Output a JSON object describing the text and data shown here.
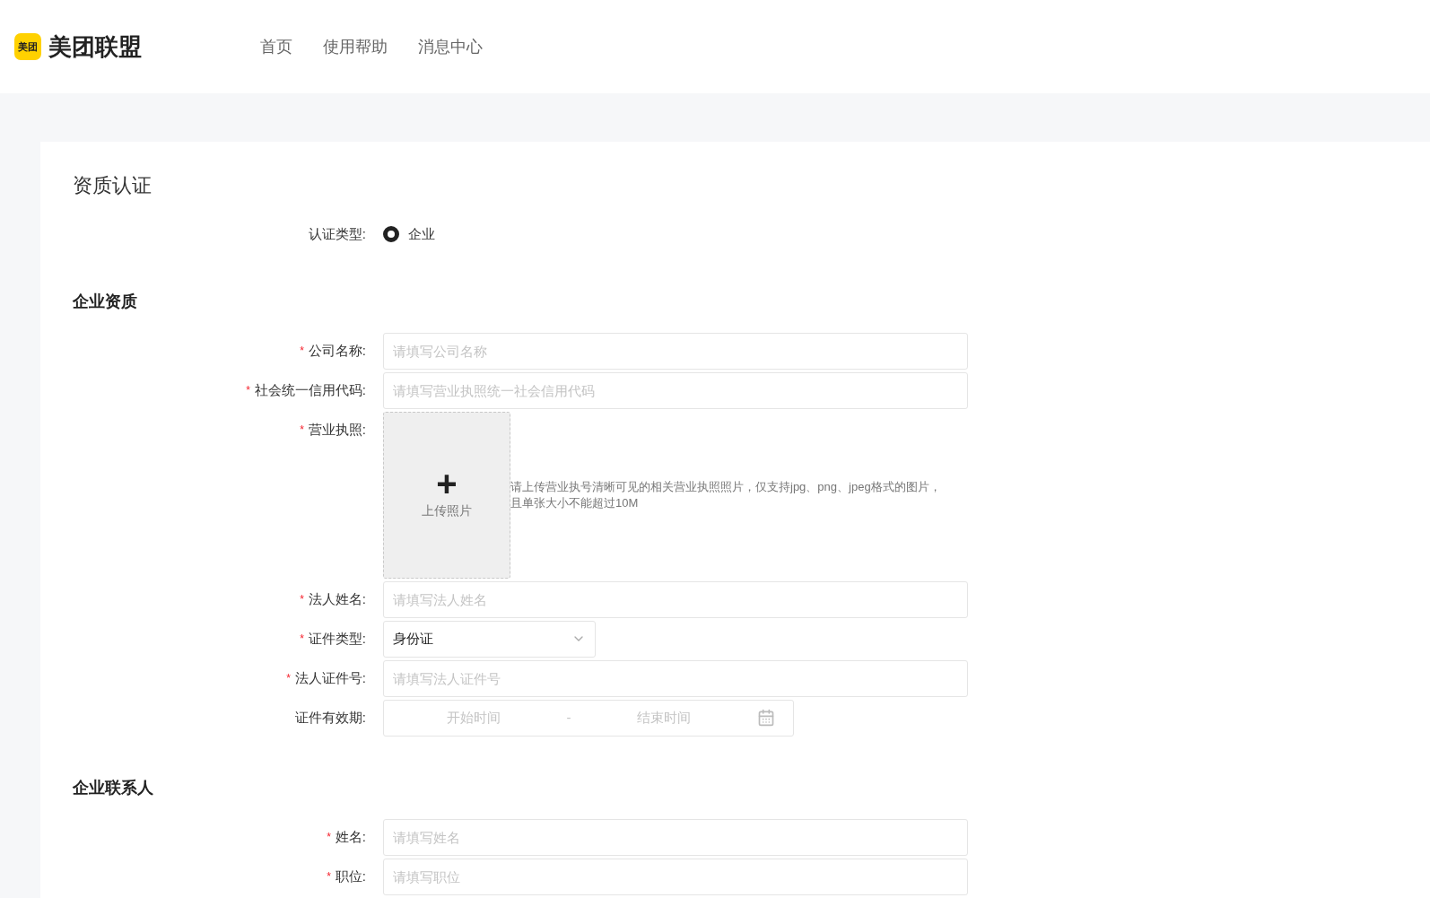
{
  "header": {
    "logo_badge": "美团",
    "logo_text": "美团联盟",
    "nav": [
      {
        "label": "首页"
      },
      {
        "label": "使用帮助"
      },
      {
        "label": "消息中心"
      }
    ]
  },
  "page_title": "资质认证",
  "cert_type": {
    "label": "认证类型:",
    "options": [
      {
        "label": "企业",
        "selected": true
      }
    ]
  },
  "sections": [
    {
      "title": "企业资质",
      "fields": [
        {
          "kind": "text",
          "label": "公司名称:",
          "required_mark": "*",
          "placeholder": "请填写公司名称"
        },
        {
          "kind": "text",
          "label": "社会统一信用代码:",
          "required_mark": "*",
          "placeholder": "请填写营业执照统一社会信用代码"
        },
        {
          "kind": "upload",
          "label": "营业执照:",
          "required_mark": "*",
          "button_icon": "+",
          "button_label": "上传照片",
          "hint": "请上传营业执号清晰可见的相关营业执照照片，仅支持jpg、png、jpeg格式的图片，且单张大小不能超过10M"
        },
        {
          "kind": "text",
          "label": "法人姓名:",
          "required_mark": "*",
          "placeholder": "请填写法人姓名"
        },
        {
          "kind": "select",
          "label": "证件类型:",
          "required_mark": "*",
          "value": "身份证"
        },
        {
          "kind": "text",
          "label": "法人证件号:",
          "required_mark": "*",
          "placeholder": "请填写法人证件号"
        },
        {
          "kind": "daterange",
          "label": "证件有效期:",
          "start_placeholder": "开始时间",
          "separator": "-",
          "end_placeholder": "结束时间"
        }
      ]
    },
    {
      "title": "企业联系人",
      "fields": [
        {
          "kind": "text",
          "label": "姓名:",
          "required_mark": "*",
          "placeholder": "请填写姓名"
        },
        {
          "kind": "text",
          "label": "职位:",
          "required_mark": "*",
          "placeholder": "请填写职位"
        }
      ]
    }
  ]
}
